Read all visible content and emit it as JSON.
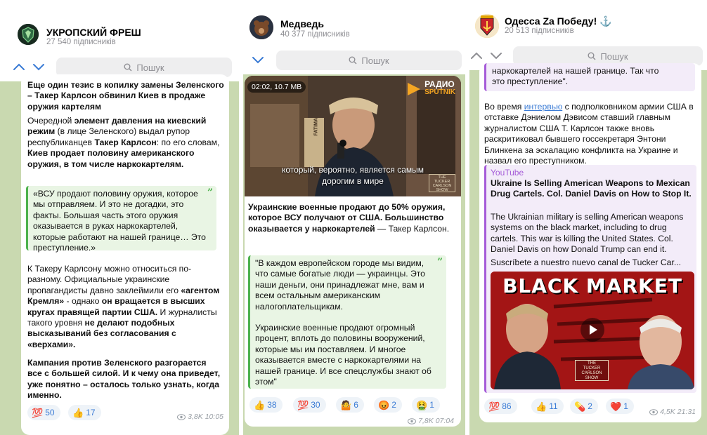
{
  "search_placeholder": "Пошук",
  "panel1": {
    "channel_name": "УКРОПСКИЙ ФРЕШ",
    "subscribers": "27 540 підписників",
    "post": {
      "headline": "Еще один тезис в копилку замены Зеленского – Такер Карлсон обвинил Киев в продаже оружия картелям",
      "p1_a": "Очередной ",
      "p1_b": "элемент давления на киевский режим",
      "p1_c": " (в лице Зеленского) выдал рупор республиканцев ",
      "p1_d": "Такер Карлсон",
      "p1_e": ": по его словам, ",
      "p1_f": "Киев продает половину американского оружия, в том числе наркокартелям.",
      "quote": "«ВСУ продают половину оружия, которое мы отправляем. И это не догадки, это факты. Большая часть этого оружия оказывается в руках наркокартелей, которые работают на нашей границе… Это преступление.»",
      "p2_a": "К Такеру Карлсону можно относиться по-разному. Официальные украинские пропагандисты давно заклеймили его ",
      "p2_b": "«агентом Кремля»",
      "p2_c": " - однако ",
      "p2_d": "он вращается в высших кругах правящей партии США.",
      "p2_e": " И журналисты такого уровня ",
      "p2_f": "не делают подобных высказываний без согласования с «верхами».",
      "p3": "Кампания против Зеленского разгорается все с большей силой. И к чему она приведет, уже понятно – осталось только узнать, когда именно."
    },
    "reactions": [
      {
        "emoji": "💯",
        "count": "50"
      },
      {
        "emoji": "👍",
        "count": "17"
      }
    ],
    "views": "3,8K",
    "time": "10:05"
  },
  "panel2": {
    "channel_name": "Медведь",
    "subscribers": "40 377 підписників",
    "video": {
      "duration": "02:02, 10.7 MB",
      "logo_top": "РАДИО",
      "logo_bottom": "SPUTNIK",
      "subtitle_1": "который, вероятно, является самым",
      "subtitle_2": "дорогим в мире",
      "badge_1": "THE",
      "badge_2": "TUCKER",
      "badge_3": "CARLSON",
      "badge_4": "SHOW",
      "book": "FATIMA"
    },
    "post": {
      "headline": "Украинские военные продают до 50% оружия, которое ВСУ получают от США. Большинство оказывается у наркокартелей",
      "headline_tail": " — Такер Карлсон.",
      "quote_1": "\"В каждом европейском городе мы видим, что самые богатые люди — украинцы. Это наши деньги, они принадлежат мне, вам и всем остальным американским налогоплательщикам.",
      "quote_2": "Украинские военные продают огромный процент, вплоть до половины вооружений, которые мы им поставляем. И многое оказывается вместе с наркокартелями на нашей границе. И все спецслужбы знают об этом\""
    },
    "reactions": [
      {
        "emoji": "👍",
        "count": "38"
      },
      {
        "emoji": "💯",
        "count": "30"
      },
      {
        "emoji": "🤷",
        "count": "6"
      },
      {
        "emoji": "😡",
        "count": "2"
      },
      {
        "emoji": "🤮",
        "count": "1"
      }
    ],
    "views": "7,8K",
    "time": "07:04"
  },
  "panel3": {
    "channel_name": "Одесса Za Победу! ⚓",
    "subscribers": "20 513 підписників",
    "post": {
      "top_quote_1": "наркокартелей на нашей границе. Так что",
      "top_quote_2": "это преступление\".",
      "p1_a": "Во время ",
      "p1_link": "интервью",
      "p1_b": " с подполковником армии США в отставке Дэниелом Дэвисом ставший главным журналистом США Т. Карлсон также вновь раскритиковал бывшего госсекретаря Энтони Блинкена за эскалацию конфликта на Украине и назвал его преступником.",
      "preview_site": "YouTube",
      "preview_title": "Ukraine Is Selling American Weapons to Mexican Drug Cartels. Col. Daniel Davis on How to Stop It.",
      "preview_desc": "The Ukrainian military is selling American weapons systems on the black market, including to drug cartels. This war is killing the United States. Col. Daniel Davis on how Donald Trump can end it.",
      "preview_desc_2": "Suscríbete a nuestro nuevo canal de Tucker Car...",
      "thumb_title": "BLACK MARKET",
      "thumb_badge_1": "THE",
      "thumb_badge_2": "TUCKER",
      "thumb_badge_3": "CARLSON",
      "thumb_badge_4": "SHOW"
    },
    "reactions": [
      {
        "emoji": "💯",
        "count": "86"
      },
      {
        "emoji": "👍",
        "count": "11"
      },
      {
        "emoji": "💊",
        "count": "2"
      },
      {
        "emoji": "❤️",
        "count": "1"
      }
    ],
    "views": "4,5K",
    "time": "21:31"
  },
  "colors": {
    "chat_background": "#c9d9b0",
    "accent": "#3a7bd5",
    "quote_bar": "#4db24d",
    "preview_bar": "#a55bd8"
  }
}
